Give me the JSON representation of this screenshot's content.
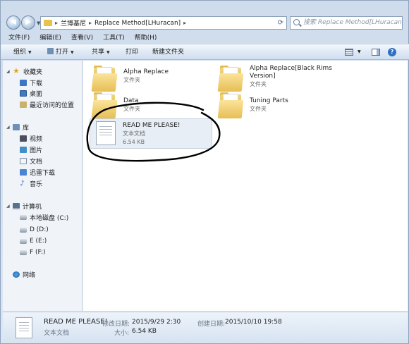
{
  "address": {
    "crumbs": [
      "兰博基尼",
      "Replace Method[LHuracan]"
    ],
    "search_placeholder": "搜索 Replace Method[LHuracan]"
  },
  "menu": [
    "文件(F)",
    "编辑(E)",
    "查看(V)",
    "工具(T)",
    "帮助(H)"
  ],
  "toolbar": {
    "organize": "组织",
    "open": "打开",
    "share": "共享",
    "print": "打印",
    "new_folder": "新建文件夹"
  },
  "sidebar": {
    "favorites": "收藏夹",
    "fav_items": [
      "下载",
      "桌面",
      "最近访问的位置"
    ],
    "libraries": "库",
    "lib_items": [
      "视频",
      "图片",
      "文档",
      "迅雷下载",
      "音乐"
    ],
    "computer": "计算机",
    "drives": [
      "本地磁盘 (C:)",
      "D (D:)",
      "E (E:)",
      "F (F:)"
    ],
    "network": "网络"
  },
  "files": [
    {
      "name": "Alpha Replace",
      "type": "文件夹"
    },
    {
      "name": "Alpha Replace[Black Rims Version]",
      "name_line1": "Alpha Replace[Black Rims",
      "name_line2": "Version]",
      "type": "文件夹"
    },
    {
      "name": "Data",
      "type": "文件夹"
    },
    {
      "name": "Tuning Parts",
      "type": "文件夹"
    },
    {
      "name": "READ ME PLEASE!",
      "type": "文本文档",
      "size": "6.54 KB"
    }
  ],
  "status": {
    "name": "READ ME PLEASE!",
    "type": "文本文档",
    "modified_label": "修改日期:",
    "modified": "2015/9/29 2:30",
    "created_label": "创建日期:",
    "created": "2015/10/10 19:58",
    "size_label": "大小:",
    "size": "6.54 KB"
  },
  "colors": {
    "window_frame": "#cfdcec",
    "folder": "#e6be56",
    "selection": "#e8eef5",
    "scribble": "#000000"
  }
}
